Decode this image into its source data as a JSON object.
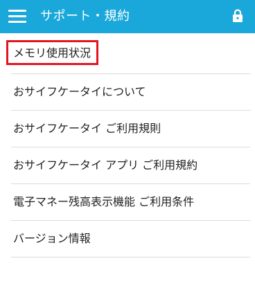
{
  "header": {
    "title": "サポート・規約",
    "menu_icon": "hamburger-menu-icon",
    "lock_icon": "lock-icon",
    "background_color": "#1aa8db"
  },
  "menu": {
    "items": [
      {
        "label": "メモリ使用状況",
        "highlighted": true
      },
      {
        "label": "おサイフケータイについて"
      },
      {
        "label": "おサイフケータイ ご利用規則"
      },
      {
        "label": "おサイフケータイ アプリ ご利用規約"
      },
      {
        "label": "電子マネー残高表示機能 ご利用条件"
      },
      {
        "label": "バージョン情報"
      }
    ]
  },
  "highlight_color": "#e3141d"
}
